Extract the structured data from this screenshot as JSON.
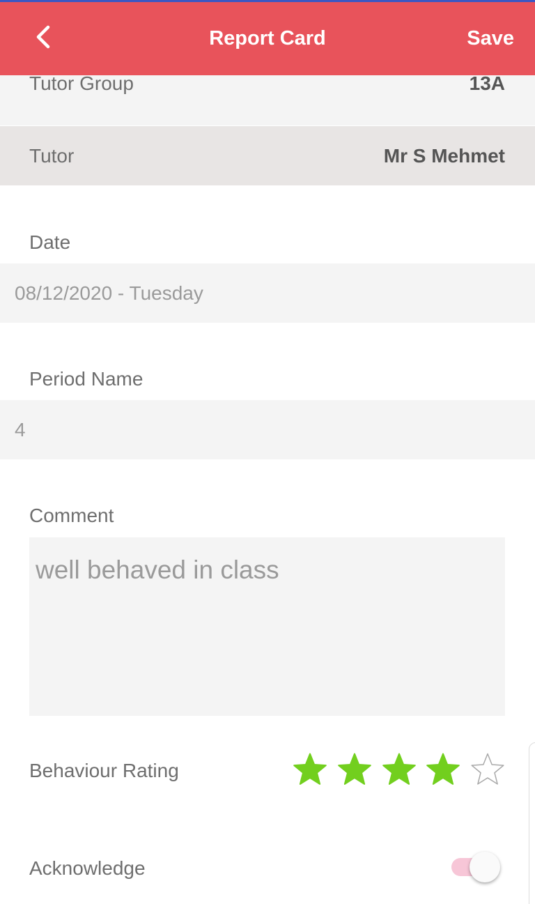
{
  "appbar": {
    "title": "Report Card",
    "save_label": "Save",
    "background": "#e8535b"
  },
  "details": {
    "tutor_group_label": "Tutor Group",
    "tutor_group_value": "13A",
    "tutor_label": "Tutor",
    "tutor_value": "Mr S Mehmet"
  },
  "date": {
    "label": "Date",
    "value": "08/12/2020 - Tuesday"
  },
  "period": {
    "label": "Period Name",
    "value": "4"
  },
  "comment": {
    "label": "Comment",
    "value": "well behaved in class"
  },
  "behaviour": {
    "label": "Behaviour Rating",
    "rating": 4,
    "max": 5,
    "filled_color": "#72cf1e"
  },
  "acknowledge": {
    "label": "Acknowledge",
    "on": true
  },
  "icons": {
    "back": "chevron-left-icon",
    "star": "star-icon"
  }
}
